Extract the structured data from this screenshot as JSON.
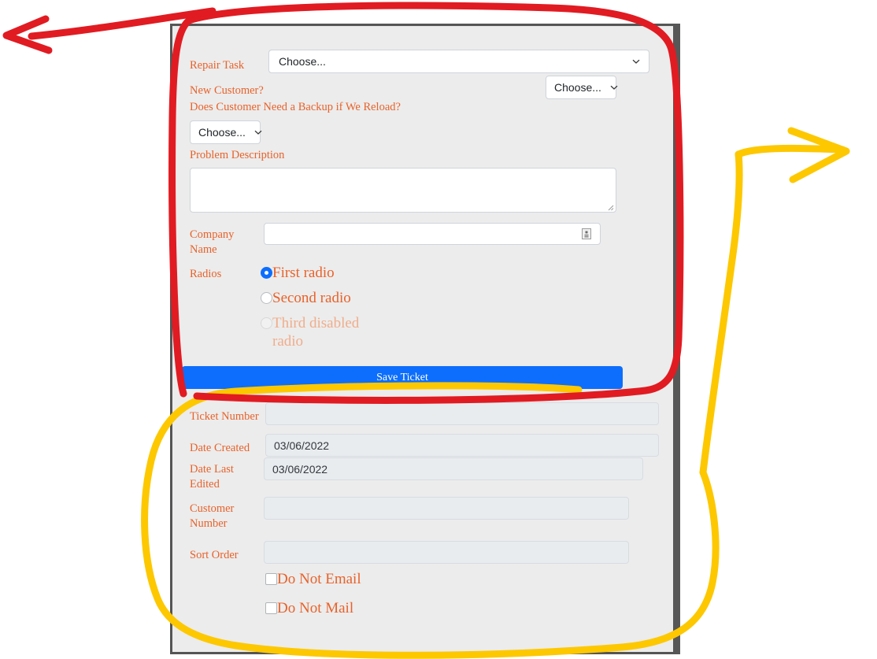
{
  "form": {
    "fields": {
      "repair_task": {
        "label": "Repair Task",
        "value": "Choose...",
        "options": [
          "Choose..."
        ]
      },
      "new_customer": {
        "label": "New Customer?",
        "value": "Choose...",
        "options": [
          "Choose..."
        ]
      },
      "needs_backup": {
        "label": "Does Customer Need a Backup if We Reload?",
        "value": "Choose...",
        "options": [
          "Choose..."
        ]
      },
      "problem_description": {
        "label": "Problem Description",
        "value": "",
        "placeholder": ""
      },
      "company_name": {
        "label": "Company\nName",
        "value": "",
        "placeholder": "",
        "icon": "contact-card-icon"
      },
      "radios": {
        "label": "Radios",
        "options": [
          {
            "label": "First radio",
            "checked": true,
            "disabled": false
          },
          {
            "label": "Second radio",
            "checked": false,
            "disabled": false
          },
          {
            "label": "Third disabled radio",
            "checked": false,
            "disabled": true
          }
        ]
      },
      "ticket_number": {
        "label": "Ticket Number",
        "value": "",
        "disabled": true
      },
      "date_created": {
        "label": "Date Created",
        "value": "03/06/2022",
        "disabled": true
      },
      "date_last_edited": {
        "label": "Date Last\nEdited",
        "value": "03/06/2022",
        "disabled": true
      },
      "customer_number": {
        "label": "Customer\nNumber",
        "value": "",
        "disabled": true
      },
      "sort_order": {
        "label": "Sort Order",
        "value": "",
        "disabled": true
      },
      "do_not_email": {
        "label": "Do Not Email",
        "checked": false
      },
      "do_not_mail": {
        "label": "Do Not Mail",
        "checked": false
      }
    },
    "save_button": {
      "label": "Save Ticket"
    }
  },
  "annotations": {
    "red": {
      "color": "#e11b22",
      "description": "red-arrow-and-box-around-upper-form-section",
      "target": "upper form fields through Save Ticket button"
    },
    "yellow": {
      "color": "#fdc800",
      "description": "yellow-arrow-and-box-around-lower-form-section",
      "target": "Ticket Number through Do Not Mail fields"
    }
  },
  "colors": {
    "label_orange": "#e8622a",
    "button_blue": "#0d6efd",
    "panel_bg": "#ececec",
    "disabled_input_bg": "#e9ecef",
    "panel_border": "#555555",
    "annotation_red": "#e11b22",
    "annotation_yellow": "#fdc800"
  }
}
